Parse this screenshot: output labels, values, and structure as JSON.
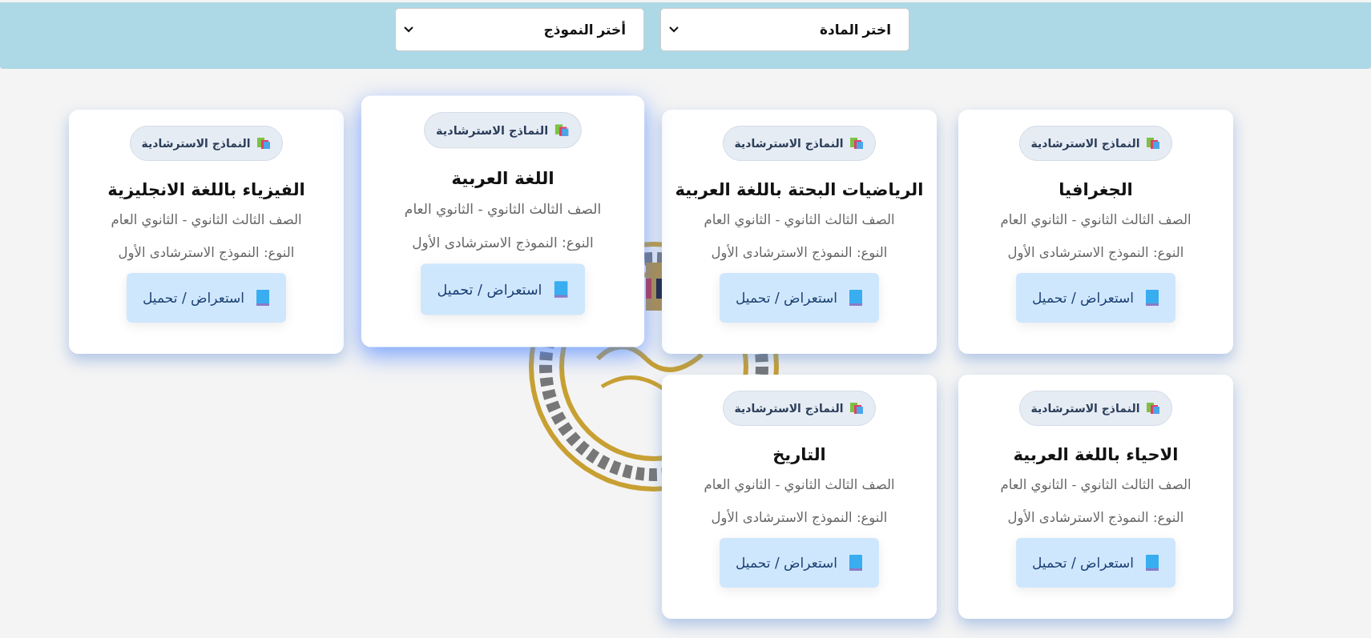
{
  "filters": [
    {
      "value": "اختر المادة"
    },
    {
      "value": "أختر النموذج"
    }
  ],
  "cards": [
    {
      "badge": "النماذج الاسترشادية",
      "title": "الجغرافيا",
      "grade": "الصف الثالث الثانوي - الثانوي العام",
      "type": "النوع: النموذج الاسترشادى الأول",
      "button": "استعراض / تحميل",
      "hovered": false
    },
    {
      "badge": "النماذج الاسترشادية",
      "title": "الرياضيات البحتة باللغة العربية",
      "grade": "الصف الثالث الثانوي - الثانوي العام",
      "type": "النوع: النموذج الاسترشادى الأول",
      "button": "استعراض / تحميل",
      "hovered": false
    },
    {
      "badge": "النماذج الاسترشادية",
      "title": "اللغة العربية",
      "grade": "الصف الثالث الثانوي - الثانوي العام",
      "type": "النوع: النموذج الاسترشادى الأول",
      "button": "استعراض / تحميل",
      "hovered": true
    },
    {
      "badge": "النماذج الاسترشادية",
      "title": "الفيزياء باللغة الانجليزية",
      "grade": "الصف الثالث الثانوي - الثانوي العام",
      "type": "النوع: النموذج الاسترشادى الأول",
      "button": "استعراض / تحميل",
      "hovered": false
    },
    {
      "badge": "النماذج الاسترشادية",
      "title": "الاحياء باللغة العربية",
      "grade": "الصف الثالث الثانوي - الثانوي العام",
      "type": "النوع: النموذج الاسترشادى الأول",
      "button": "استعراض / تحميل",
      "hovered": false
    },
    {
      "badge": "النماذج الاسترشادية",
      "title": "التاريخ",
      "grade": "الصف الثالث الثانوي - الثانوي العام",
      "type": "النوع: النموذج الاسترشادى الأول",
      "button": "استعراض / تحميل",
      "hovered": false
    }
  ]
}
